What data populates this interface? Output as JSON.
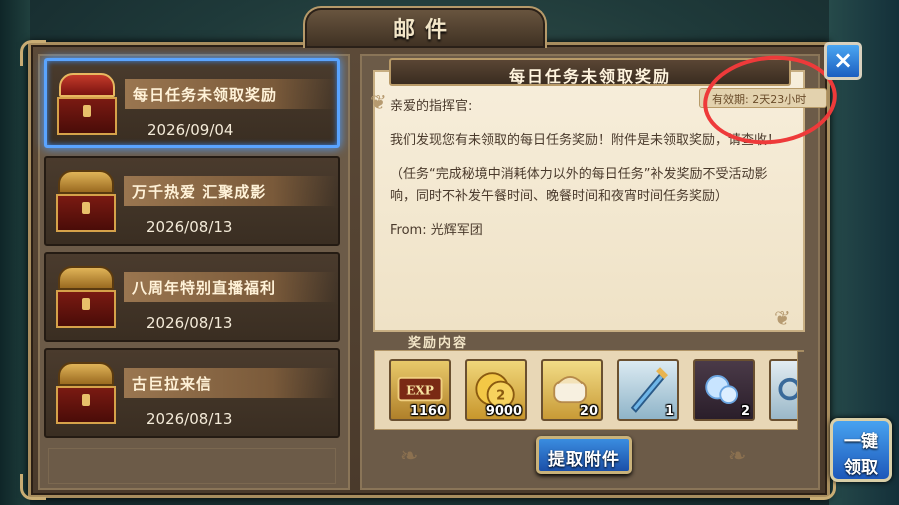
{
  "window": {
    "title": "邮件"
  },
  "mail_list": [
    {
      "title": "每日任务未领取奖励",
      "date": "2026/09/04",
      "selected": true,
      "chest": "red"
    },
    {
      "title": "万千热爱 汇聚成影",
      "date": "2026/08/13",
      "selected": false,
      "chest": "gold"
    },
    {
      "title": "八周年特别直播福利",
      "date": "2026/08/13",
      "selected": false,
      "chest": "gold"
    },
    {
      "title": "古巨拉来信",
      "date": "2026/08/13",
      "selected": false,
      "chest": "gold"
    }
  ],
  "letter": {
    "title": "每日任务未领取奖励",
    "expiry": "有效期: 2天23小时",
    "greeting": "亲爱的指挥官:",
    "paragraph1": "我们发现您有未领取的每日任务奖励！附件是未领取奖励，请查收！",
    "paragraph2": "（任务“完成秘境中消耗体力以外的每日任务”补发奖励不受活动影响，同时不补发午餐时间、晚餐时间和夜宵时间任务奖励）",
    "from": "From: 光辉军团"
  },
  "rewards": {
    "header": "奖励内容",
    "items": [
      {
        "icon": "exp-icon",
        "qty": "1160"
      },
      {
        "icon": "gold-coin-icon",
        "qty": "9000"
      },
      {
        "icon": "bread-icon",
        "qty": "20"
      },
      {
        "icon": "sword-icon",
        "qty": "1"
      },
      {
        "icon": "crystal-icon",
        "qty": "2"
      },
      {
        "icon": "ring-icon",
        "qty": ""
      }
    ]
  },
  "buttons": {
    "extract": "提取附件",
    "claim_all_line1": "一键",
    "claim_all_line2": "领取",
    "close": "×"
  },
  "colors": {
    "selected_border": "#5aa4ff",
    "annotation_circle": "#ee3a3a",
    "button_blue": "#1b4fa8"
  }
}
